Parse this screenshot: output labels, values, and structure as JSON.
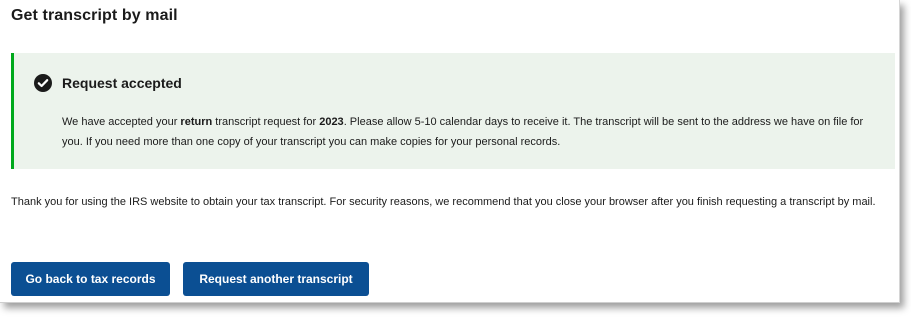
{
  "page": {
    "title": "Get transcript by mail"
  },
  "alert": {
    "status": "success",
    "icon": "check-circle-icon",
    "heading": "Request accepted",
    "body_part1": "We have accepted your ",
    "transcript_type": "return",
    "body_part2": " transcript request for ",
    "tax_year": "2023",
    "body_part3": ". Please allow 5-10 calendar days to receive it. The transcript will be sent to the address we have on file for you. If you need more than one copy of your transcript you can make copies for your personal records.",
    "colors": {
      "background": "#ecf3ec",
      "border": "#00a91c"
    }
  },
  "message": {
    "thanks": "Thank you for using the IRS website to obtain your tax transcript. For security reasons, we recommend that you close your browser after you finish requesting a transcript by mail."
  },
  "actions": {
    "back_label": "Go back to tax records",
    "another_label": "Request another transcript",
    "button_color": "#0b4f93"
  }
}
